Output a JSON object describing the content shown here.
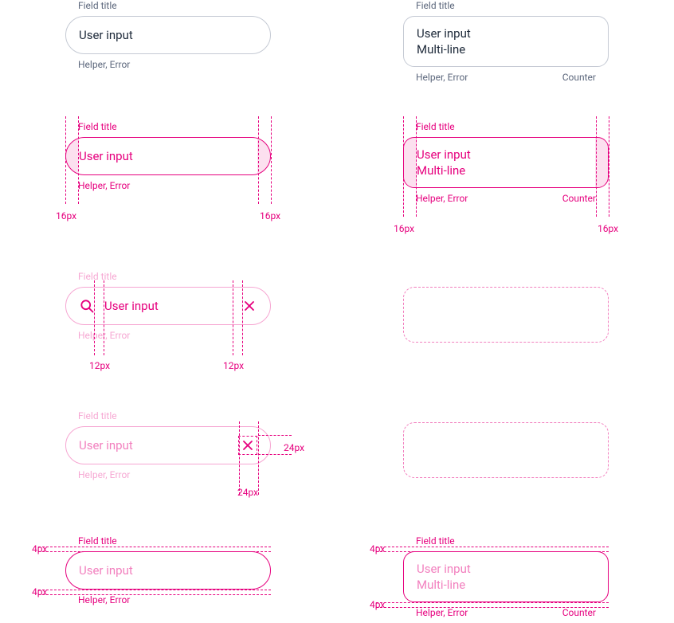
{
  "shared": {
    "field_title": "Field title",
    "user_input": "User input",
    "multiline2": "Multi-line",
    "helper_error": "Helper, Error",
    "counter": "Counter"
  },
  "measurements": {
    "px16": "16px",
    "px12": "12px",
    "px24": "24px",
    "px4": "4px"
  }
}
